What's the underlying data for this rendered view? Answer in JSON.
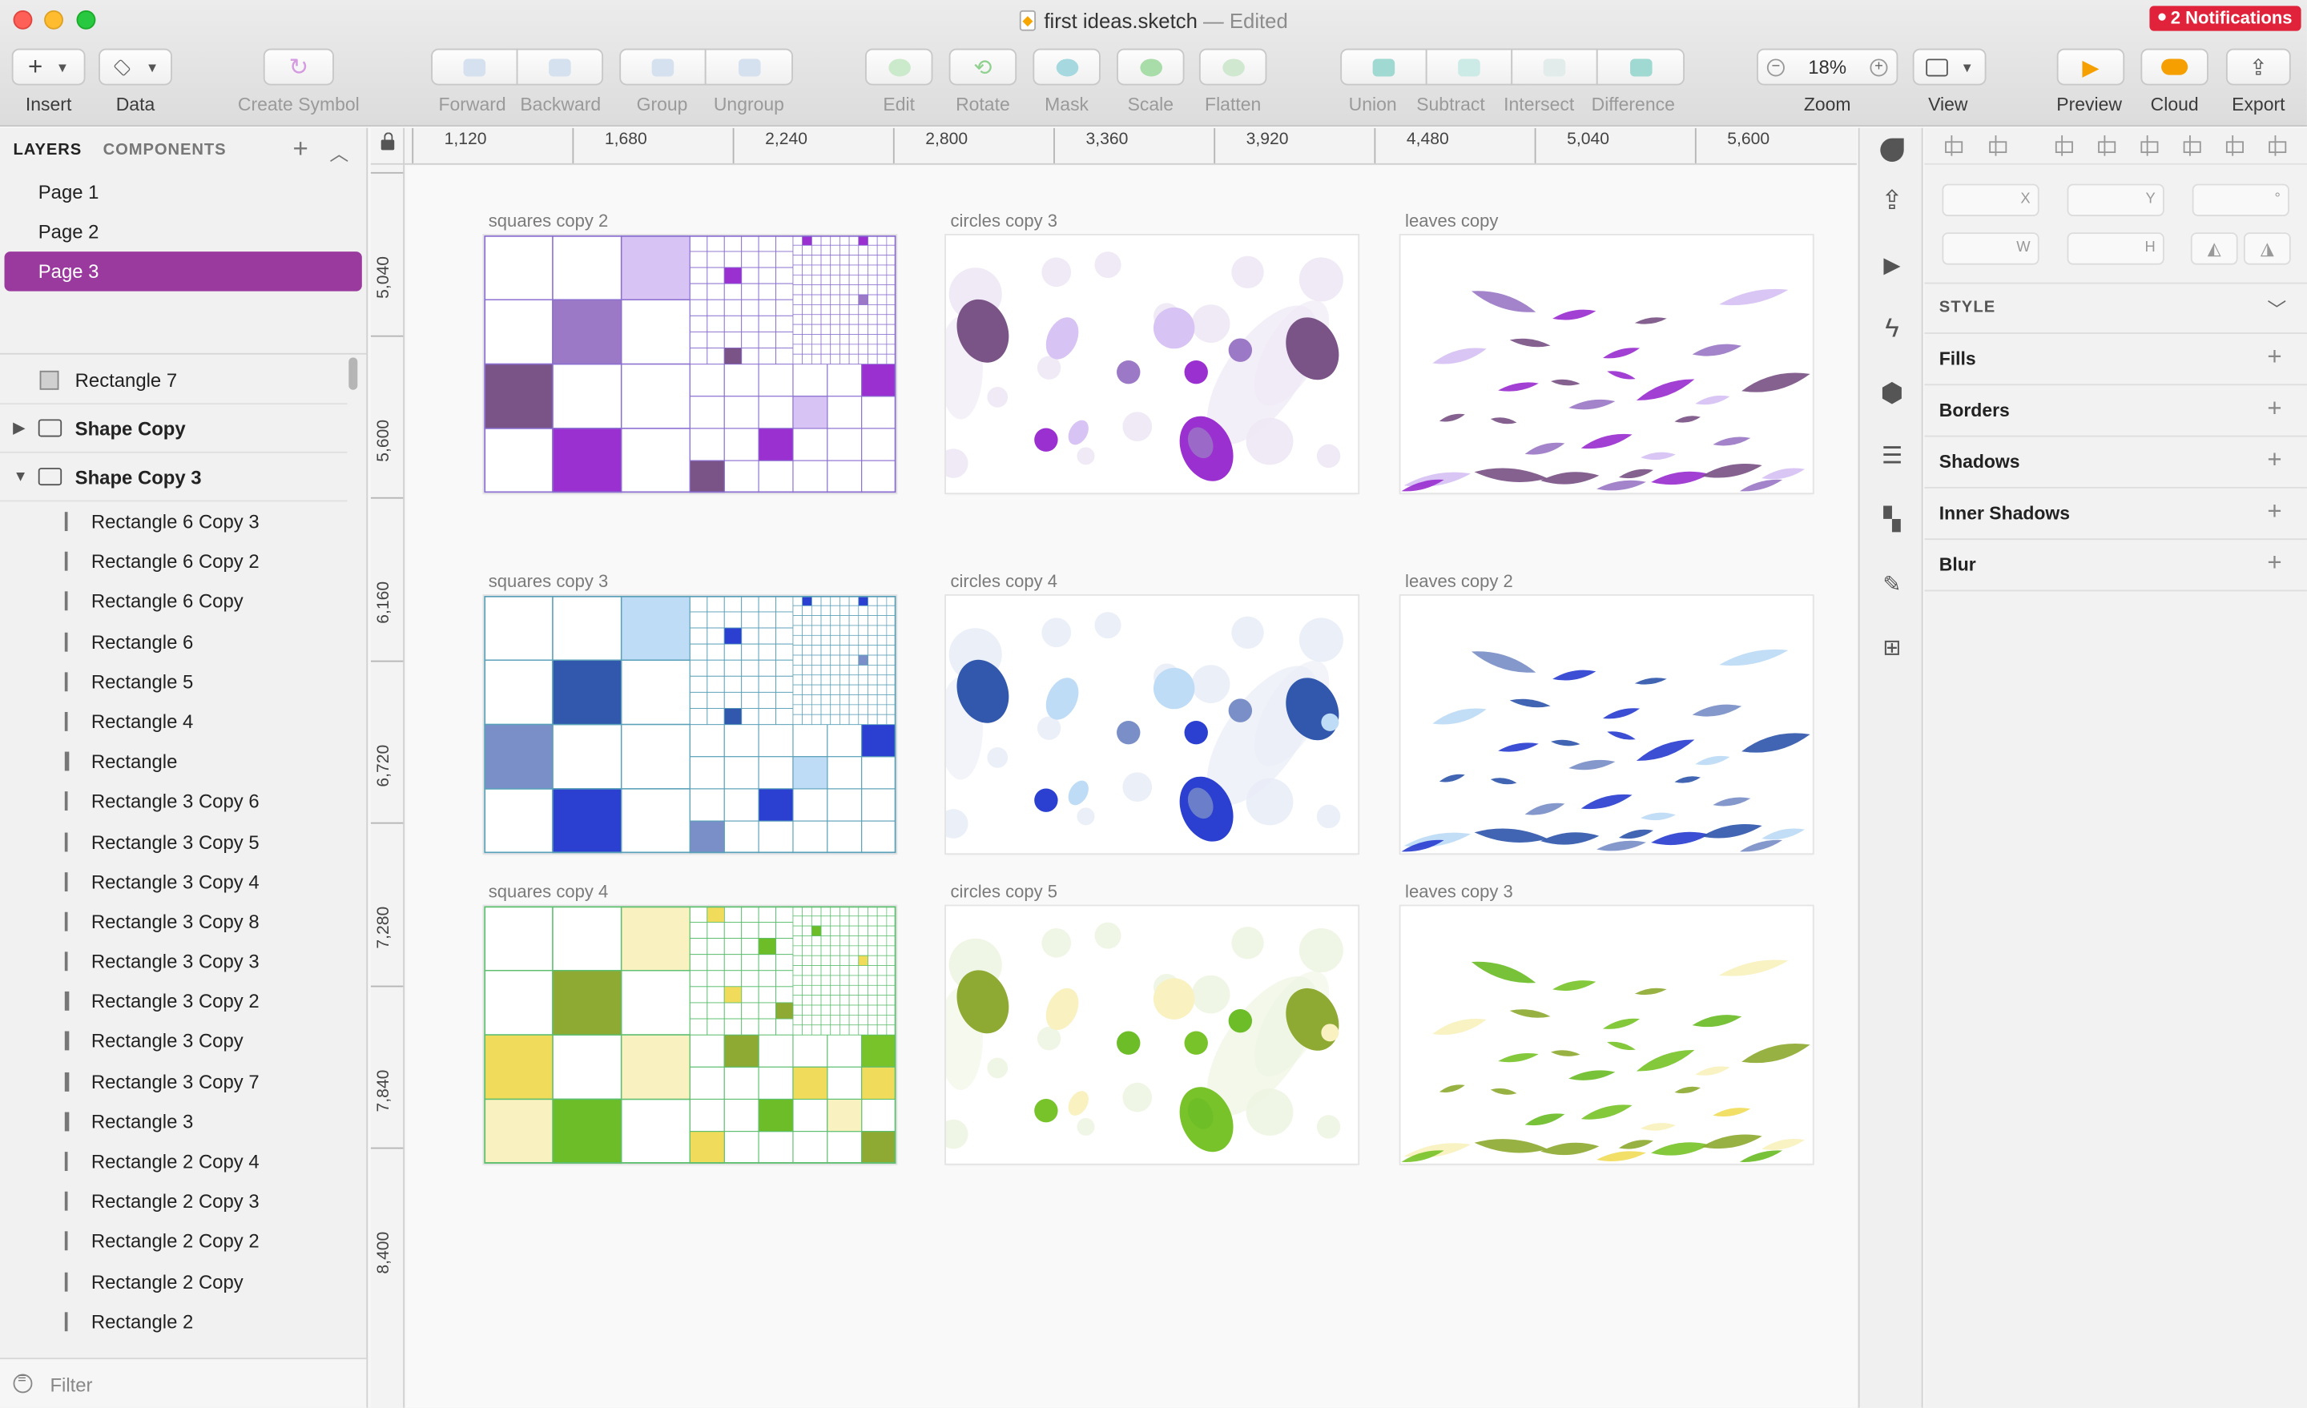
{
  "window": {
    "title": "first ideas.sketch",
    "edited_suffix": "— Edited",
    "notifications": "2 Notifications"
  },
  "toolbar": {
    "insert": "Insert",
    "data": "Data",
    "create_symbol": "Create Symbol",
    "forward": "Forward",
    "backward": "Backward",
    "group": "Group",
    "ungroup": "Ungroup",
    "edit": "Edit",
    "rotate": "Rotate",
    "mask": "Mask",
    "scale": "Scale",
    "flatten": "Flatten",
    "union": "Union",
    "subtract": "Subtract",
    "intersect": "Intersect",
    "difference": "Difference",
    "zoom": "Zoom",
    "zoom_value": "18%",
    "zoom_minus": "−",
    "zoom_plus": "+",
    "view": "View",
    "preview": "Preview",
    "cloud": "Cloud",
    "export": "Export"
  },
  "sidebar": {
    "tab_layers": "LAYERS",
    "tab_components": "COMPONENTS",
    "pages": [
      "Page 1",
      "Page 2",
      "Page 3"
    ],
    "selected_page": "Page 3",
    "layers": [
      {
        "label": "Rectangle 7",
        "kind": "rect"
      },
      {
        "label": "Shape Copy",
        "kind": "group-collapsed"
      },
      {
        "label": "Shape Copy 3",
        "kind": "group-expanded"
      },
      {
        "label": "Rectangle 6 Copy 3",
        "kind": "child"
      },
      {
        "label": "Rectangle 6 Copy 2",
        "kind": "child"
      },
      {
        "label": "Rectangle 6 Copy",
        "kind": "child"
      },
      {
        "label": "Rectangle 6",
        "kind": "child"
      },
      {
        "label": "Rectangle 5",
        "kind": "child"
      },
      {
        "label": "Rectangle 4",
        "kind": "child"
      },
      {
        "label": "Rectangle",
        "kind": "child-thick"
      },
      {
        "label": "Rectangle 3 Copy 6",
        "kind": "child"
      },
      {
        "label": "Rectangle 3 Copy 5",
        "kind": "child"
      },
      {
        "label": "Rectangle 3 Copy 4",
        "kind": "child"
      },
      {
        "label": "Rectangle 3 Copy 8",
        "kind": "child"
      },
      {
        "label": "Rectangle 3 Copy 3",
        "kind": "child"
      },
      {
        "label": "Rectangle 3 Copy 2",
        "kind": "child-thick"
      },
      {
        "label": "Rectangle 3 Copy",
        "kind": "child-thick"
      },
      {
        "label": "Rectangle 3 Copy 7",
        "kind": "child-thick"
      },
      {
        "label": "Rectangle 3",
        "kind": "child-thick"
      },
      {
        "label": "Rectangle 2 Copy 4",
        "kind": "child"
      },
      {
        "label": "Rectangle 2 Copy 3",
        "kind": "child"
      },
      {
        "label": "Rectangle 2 Copy 2",
        "kind": "child"
      },
      {
        "label": "Rectangle 2 Copy",
        "kind": "child"
      },
      {
        "label": "Rectangle 2",
        "kind": "child"
      }
    ],
    "filter_placeholder": "Filter"
  },
  "rulers": {
    "top": [
      "1,120",
      "1,680",
      "2,240",
      "2,800",
      "3,360",
      "3,920",
      "4,480",
      "5,040",
      "5,600"
    ],
    "left": [
      "5,040",
      "5,600",
      "6,160",
      "6,720",
      "7,280",
      "7,840",
      "8,400"
    ]
  },
  "artboards": [
    {
      "title": "squares copy 2",
      "type": "squares",
      "palette": "purple"
    },
    {
      "title": "circles copy 3",
      "type": "circles",
      "palette": "purple"
    },
    {
      "title": "leaves copy",
      "type": "leaves",
      "palette": "purple"
    },
    {
      "title": "squares copy 3",
      "type": "squares",
      "palette": "blue"
    },
    {
      "title": "circles copy 4",
      "type": "circles",
      "palette": "blue"
    },
    {
      "title": "leaves copy 2",
      "type": "leaves",
      "palette": "blue"
    },
    {
      "title": "squares copy 4",
      "type": "squares",
      "palette": "green"
    },
    {
      "title": "circles copy 5",
      "type": "circles",
      "palette": "green"
    },
    {
      "title": "leaves copy 3",
      "type": "leaves",
      "palette": "green"
    }
  ],
  "palettes": {
    "purple": {
      "line": "#8a6fd0",
      "c1": "#7b5487",
      "c2": "#9b79c6",
      "c3": "#9a30d0",
      "c4": "#d7c3f4",
      "c5": "#eee8f5"
    },
    "blue": {
      "line": "#5aa0b8",
      "c1": "#3158ad",
      "c2": "#7a8fc8",
      "c3": "#2b3fd0",
      "c4": "#bfdcf7",
      "c5": "#e9edf7"
    },
    "green": {
      "line": "#5dbf6f",
      "c1": "#8faa33",
      "c2": "#6cbd28",
      "c3": "#79c32a",
      "c4": "#f9f1bf",
      "c5": "#eef5e2",
      "c6": "#f0dc5a"
    }
  },
  "inspector": {
    "x_label": "X",
    "y_label": "Y",
    "w_label": "W",
    "h_label": "H",
    "rot_label": "°",
    "style": "STYLE",
    "sections": [
      "Fills",
      "Borders",
      "Shadows",
      "Inner Shadows",
      "Blur"
    ]
  },
  "colors": {
    "selection": "#9b3a9e",
    "notification": "#e0233a"
  }
}
